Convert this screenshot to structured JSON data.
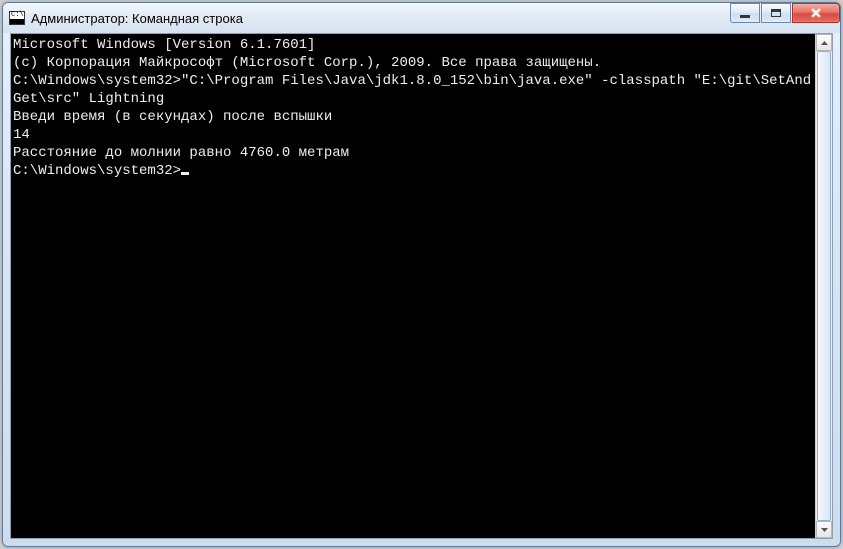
{
  "window": {
    "title": "Администратор: Командная строка"
  },
  "terminal": {
    "lines": [
      "Microsoft Windows [Version 6.1.7601]",
      "(c) Корпорация Майкрософт (Microsoft Corp.), 2009. Все права защищены.",
      "",
      "C:\\Windows\\system32>\"C:\\Program Files\\Java\\jdk1.8.0_152\\bin\\java.exe\" -classpath \"E:\\git\\SetAndGet\\src\" Lightning",
      "Введи время (в секундах) после вспышки",
      "14",
      "Расстояние до молнии равно 4760.0 метрам",
      "",
      "C:\\Windows\\system32>"
    ]
  }
}
